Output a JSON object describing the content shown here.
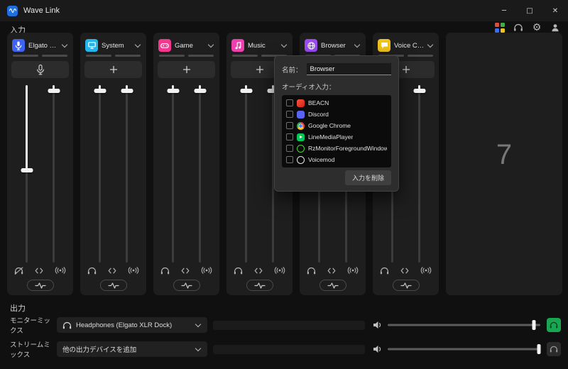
{
  "titlebar": {
    "title": "Wave Link",
    "minimize_glyph": "─",
    "maximize_glyph": "□",
    "close_glyph": "✕"
  },
  "icons": {
    "settings_glyph": "⚙"
  },
  "sections": {
    "input_label": "入力",
    "output_label": "出力"
  },
  "channels": [
    {
      "name": "Elgato XLR ...",
      "color": "#3e63f0",
      "icon": "mic-icon",
      "fader_left": "48%",
      "fader_right": "3%"
    },
    {
      "name": "System",
      "color": "#23b6ee",
      "icon": "monitor-icon",
      "fader_left": "3%",
      "fader_right": "3%"
    },
    {
      "name": "Game",
      "color": "#f2388f",
      "icon": "gamepad-icon",
      "fader_left": "3%",
      "fader_right": "3%"
    },
    {
      "name": "Music",
      "color": "#ee3fae",
      "icon": "music-note-icon",
      "fader_left": "3%",
      "fader_right": "3%"
    },
    {
      "name": "Browser",
      "color": "#9a4cf2",
      "icon": "browser-icon",
      "fader_left": "3%",
      "fader_right": "3%"
    },
    {
      "name": "Voice Chat",
      "color": "#eec41d",
      "icon": "chat-bubble-icon",
      "fader_left": "3%",
      "fader_right": "3%"
    }
  ],
  "popup": {
    "name_label": "名前：",
    "name_value": "Browser",
    "audio_input_label": "オーディオ入力：",
    "sources": [
      {
        "label": "BEACN",
        "color": "#e8432f"
      },
      {
        "label": "Discord",
        "color": "#5865f2"
      },
      {
        "label": "Google Chrome",
        "color": "#4285f4"
      },
      {
        "label": "LineMediaPlayer",
        "color": "#06c755"
      },
      {
        "label": "RzMonitorForegroundWindow",
        "color": "#44d62c"
      },
      {
        "label": "Voicemod",
        "color": "#f2f2f2"
      }
    ],
    "remove_button": "入力を削除"
  },
  "right_panel": {
    "value": "7"
  },
  "output": {
    "rows": [
      {
        "label": "モニターミックス",
        "device": "Headphones (Elgato XLR Dock)",
        "volume": "96%",
        "button_color": "#17a750"
      },
      {
        "label": "ストリームミックス",
        "device": "他の出力デバイスを追加",
        "volume": "99%",
        "button_color": "#2b2b2b"
      }
    ]
  }
}
